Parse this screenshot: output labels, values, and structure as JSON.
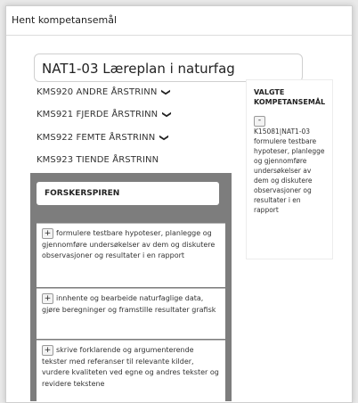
{
  "modal": {
    "title": "Hent kompetansemål"
  },
  "curriculum": {
    "value": "NAT1-03 Læreplan i naturfag"
  },
  "levels": [
    {
      "label": "KMS920 ANDRE ÅRSTRINN",
      "expanded": false
    },
    {
      "label": "KMS921 FJERDE ÅRSTRINN",
      "expanded": false
    },
    {
      "label": "KMS922 FEMTE ÅRSTRINN",
      "expanded": false
    },
    {
      "label": "KMS923 TIENDE ÅRSTRINN",
      "expanded": true
    }
  ],
  "icons": {
    "chevron": "chevron-down-icon",
    "add": "plus-icon",
    "remove": "minus-icon"
  },
  "panel": {
    "heading": "FORSKERSPIREN",
    "goals": [
      {
        "add": "+",
        "text": "formulere testbare hypoteser, planlegge og gjennomføre undersøkelser av dem og diskutere observasjoner og resultater i en rapport"
      },
      {
        "add": "+",
        "text": "innhente og bearbeide naturfaglige data, gjøre beregninger og framstille resultater grafisk"
      },
      {
        "add": "+",
        "text": "skrive forklarende og argumenterende tekster med referanser til relevante kilder, vurdere kvaliteten ved egne og andres tekster og revidere tekstene"
      }
    ]
  },
  "selected": {
    "title": "VALGTE KOMPETANSEMÅL",
    "items": [
      {
        "remove": "-",
        "text": "K15081|NAT1-03 formulere testbare hypoteser, planlegge og gjennomføre undersøkelser av dem og diskutere observasjoner og resultater i en rapport"
      }
    ]
  },
  "colors": {
    "panel_bg": "#7d7d7d",
    "page_bg": "#e9e9e9"
  }
}
